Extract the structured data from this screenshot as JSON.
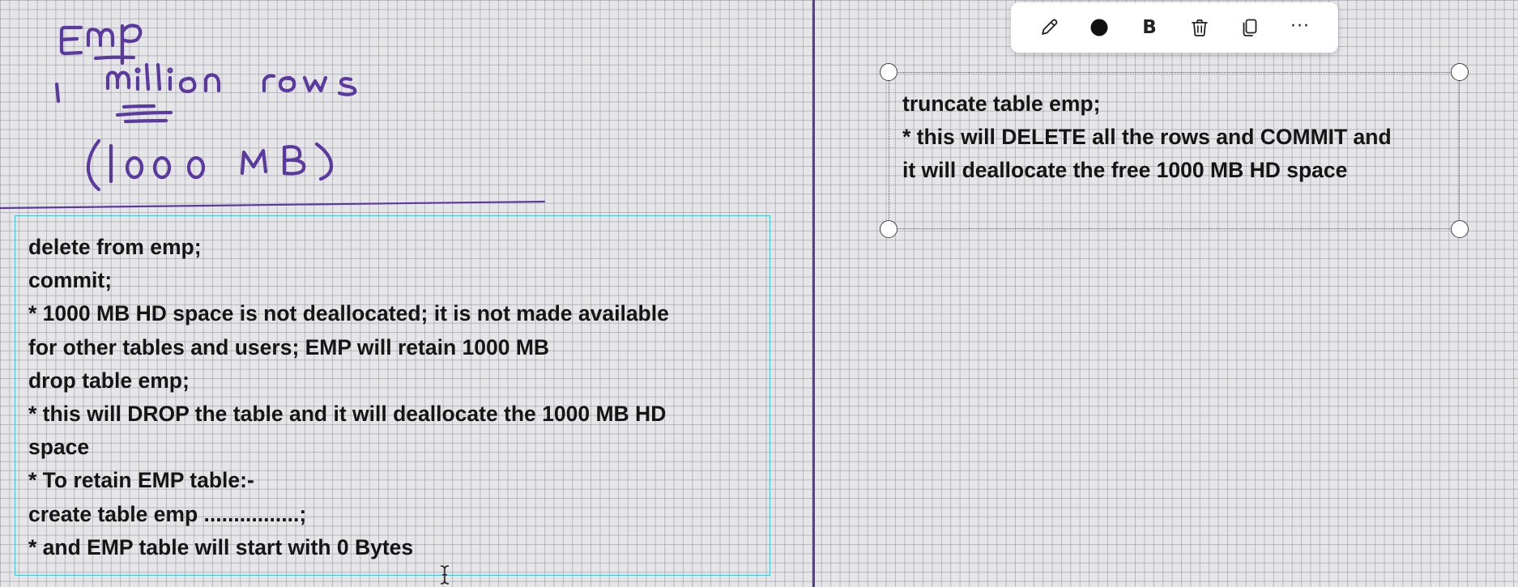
{
  "handwriting": {
    "line1": "EMP",
    "line2": "1 million rows",
    "line3": "(1000 MB)"
  },
  "left_note": {
    "lines": [
      "delete from emp;",
      "commit;",
      "* 1000 MB HD space is not deallocated; it is not made available",
      "for other tables and users; EMP will retain 1000 MB",
      "drop table emp;",
      "* this will DROP the table and it will deallocate the 1000 MB HD",
      "space",
      "* To retain EMP table:-",
      "create table emp ................;",
      "* and EMP table will start with 0 Bytes"
    ]
  },
  "right_note": {
    "lines": [
      "truncate table emp;",
      "* this will DELETE all the rows and COMMIT and",
      "it will deallocate the free 1000 MB HD space"
    ]
  },
  "toolbar": {
    "bold_label": "B",
    "more_label": "···",
    "icons": [
      "pencil-icon",
      "color-dot-icon",
      "bold-icon",
      "trash-icon",
      "copy-icon",
      "more-icon"
    ]
  },
  "colors": {
    "ink": "#5b3aa0",
    "selection_border": "#3ec3da",
    "canvas_bg": "#e6e6e9"
  }
}
